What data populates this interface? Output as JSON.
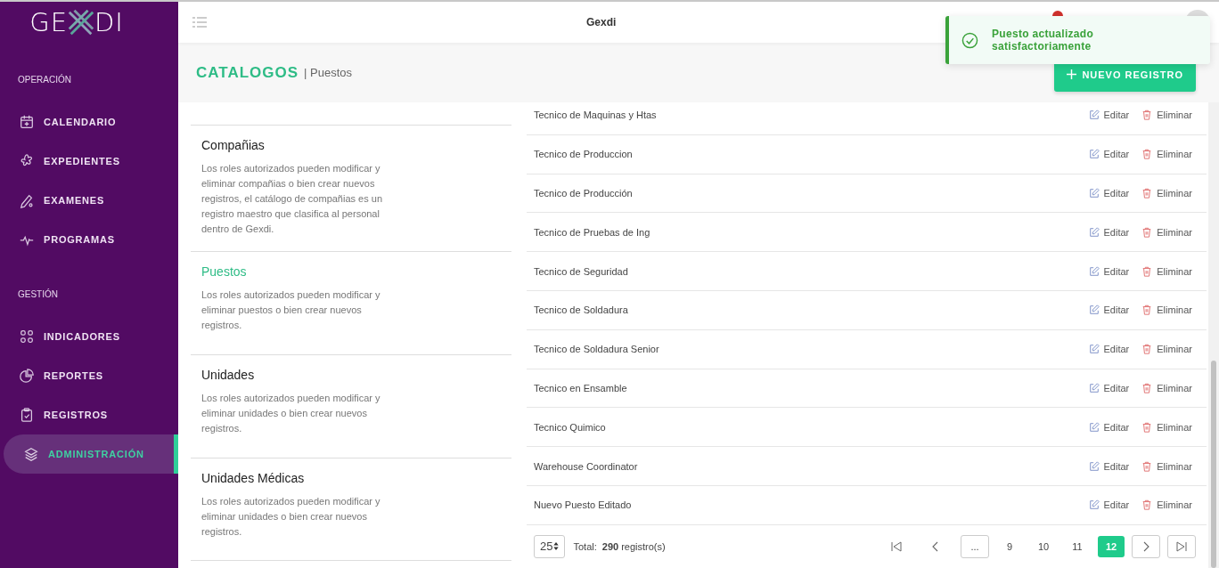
{
  "logo": {
    "left": "GE",
    "right": "DI"
  },
  "sidebar": {
    "sections": [
      {
        "title": "OPERACIÓN",
        "items": [
          {
            "label": "CALENDARIO",
            "selected": false
          },
          {
            "label": "EXPEDIENTES",
            "selected": false
          },
          {
            "label": "EXAMENES",
            "selected": false
          },
          {
            "label": "PROGRAMAS",
            "selected": false
          }
        ]
      },
      {
        "title": "GESTIÓN",
        "items": [
          {
            "label": "INDICADORES",
            "selected": false
          },
          {
            "label": "REPORTES",
            "selected": false
          },
          {
            "label": "REGISTROS",
            "selected": false
          },
          {
            "label": "ADMINISTRACIÓN",
            "selected": true
          }
        ]
      }
    ]
  },
  "header": {
    "title": "Gexdi"
  },
  "toast": {
    "message": "Puesto actualizado satisfactoriamente"
  },
  "page": {
    "title": "CATALOGOS",
    "subtitle": "| Puestos",
    "new_button": "NUEVO REGISTRO"
  },
  "catalogs": [
    {
      "title": "Compañias",
      "description": "Los roles autorizados pueden modificar y eliminar compañias o bien crear nuevos registros, el catálogo de compañias es un registro maestro que clasifica al personal dentro de Gexdi.",
      "selected": false
    },
    {
      "title": "Puestos",
      "description": "Los roles autorizados pueden modificar y eliminar puestos o bien crear nuevos registros.",
      "selected": true
    },
    {
      "title": "Unidades",
      "description": "Los roles autorizados pueden modificar y eliminar unidades o bien crear nuevos registros.",
      "selected": false
    },
    {
      "title": "Unidades Médicas",
      "description": "Los roles autorizados pueden modificar y eliminar unidades o bien crear nuevos registros.",
      "selected": false
    }
  ],
  "table": {
    "rows": [
      {
        "name": "Tecnico de Maquinas y Htas",
        "edit": "Editar",
        "delete": "Eliminar"
      },
      {
        "name": "Tecnico de Produccion",
        "edit": "Editar",
        "delete": "Eliminar"
      },
      {
        "name": "Tecnico de Producción",
        "edit": "Editar",
        "delete": "Eliminar"
      },
      {
        "name": "Tecnico de Pruebas de Ing",
        "edit": "Editar",
        "delete": "Eliminar"
      },
      {
        "name": "Tecnico de Seguridad",
        "edit": "Editar",
        "delete": "Eliminar"
      },
      {
        "name": "Tecnico de Soldadura",
        "edit": "Editar",
        "delete": "Eliminar"
      },
      {
        "name": "Tecnico de Soldadura Senior",
        "edit": "Editar",
        "delete": "Eliminar"
      },
      {
        "name": "Tecnico en Ensamble",
        "edit": "Editar",
        "delete": "Eliminar"
      },
      {
        "name": "Tecnico Quimico",
        "edit": "Editar",
        "delete": "Eliminar"
      },
      {
        "name": "Warehouse Coordinator",
        "edit": "Editar",
        "delete": "Eliminar"
      },
      {
        "name": "Nuevo Puesto Editado",
        "edit": "Editar",
        "delete": "Eliminar"
      }
    ]
  },
  "pagination": {
    "page_size": "25",
    "total_label": "Total:",
    "total": "290",
    "total_unit": "registro(s)",
    "ellipsis": "...",
    "pages": [
      {
        "label": "9",
        "selected": false
      },
      {
        "label": "10",
        "selected": false
      },
      {
        "label": "11",
        "selected": false
      },
      {
        "label": "12",
        "selected": true
      }
    ]
  }
}
